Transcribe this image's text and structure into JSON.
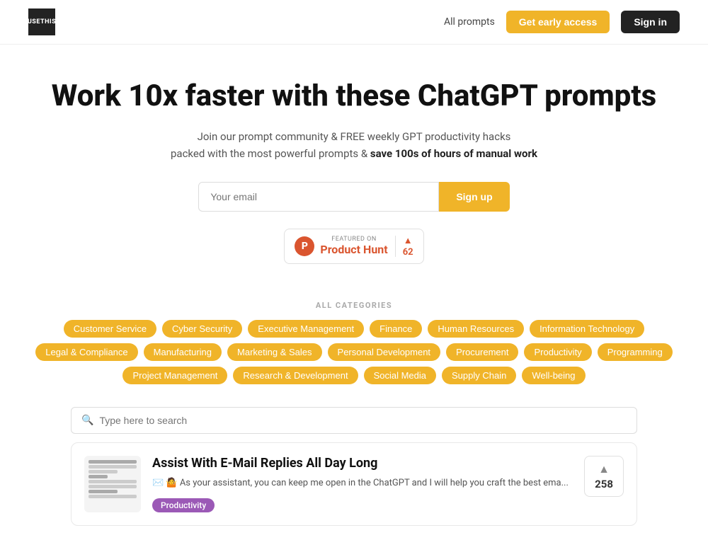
{
  "nav": {
    "logo_line1": "USE",
    "logo_line2": "THIS",
    "all_prompts_label": "All prompts",
    "early_access_label": "Get early access",
    "signin_label": "Sign in"
  },
  "hero": {
    "headline": "Work 10x faster with these ChatGPT prompts",
    "sub_line1": "Join our prompt community & FREE weekly GPT productivity hacks",
    "sub_line2_plain": "packed with the most powerful prompts & ",
    "sub_line2_bold": "save 100s of hours of manual work"
  },
  "email_form": {
    "placeholder": "Your email",
    "signup_label": "Sign up"
  },
  "product_hunt": {
    "featured_label": "FEATURED ON",
    "name": "Product Hunt",
    "votes": "62",
    "icon_letter": "P"
  },
  "categories": {
    "section_label": "ALL CATEGORIES",
    "tags": [
      "Customer Service",
      "Cyber Security",
      "Executive Management",
      "Finance",
      "Human Resources",
      "Information Technology",
      "Legal & Compliance",
      "Manufacturing",
      "Marketing & Sales",
      "Personal Development",
      "Procurement",
      "Productivity",
      "Programming",
      "Project Management",
      "Research & Development",
      "Social Media",
      "Supply Chain",
      "Well-being"
    ]
  },
  "search": {
    "placeholder": "Type here to search"
  },
  "cards": [
    {
      "title": "Assist With E-Mail Replies All Day Long",
      "description": "✉️ 🤷 As your assistant, you can keep me open in the ChatGPT and I will help you craft the best ema...",
      "tag": "Productivity",
      "votes": "258"
    }
  ]
}
